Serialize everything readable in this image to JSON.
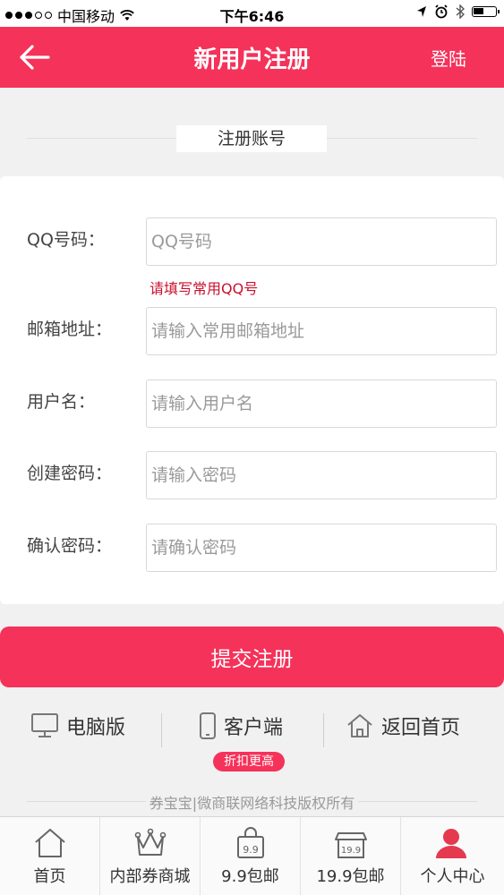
{
  "status_bar": {
    "carrier": "中国移动",
    "time": "下午6:46"
  },
  "nav": {
    "title": "新用户注册",
    "login": "登陆"
  },
  "section_title": "注册账号",
  "form": {
    "qq": {
      "label": "QQ号码：",
      "placeholder": "QQ号码",
      "hint": "请填写常用QQ号"
    },
    "email": {
      "label": "邮箱地址：",
      "placeholder": "请输入常用邮箱地址"
    },
    "username": {
      "label": "用户名：",
      "placeholder": "请输入用户名"
    },
    "password": {
      "label": "创建密码：",
      "placeholder": "请输入密码"
    },
    "confirm": {
      "label": "确认密码：",
      "placeholder": "请确认密码"
    }
  },
  "submit_label": "提交注册",
  "links": {
    "pc": "电脑版",
    "client": "客户端",
    "home": "返回首页",
    "badge": "折扣更高"
  },
  "copyright": "券宝宝|微商联网络科技版权所有",
  "tabs": [
    {
      "label": "首页",
      "icon": "home-icon"
    },
    {
      "label": "内部券商城",
      "icon": "crown-icon"
    },
    {
      "label": "9.9包邮",
      "icon": "bag-icon",
      "icon_text": "9.9"
    },
    {
      "label": "19.9包邮",
      "icon": "shop-icon",
      "icon_text": "19.9"
    },
    {
      "label": "个人中心",
      "icon": "user-icon"
    }
  ],
  "colors": {
    "brand": "#f5325a",
    "hint": "#c8102e"
  }
}
